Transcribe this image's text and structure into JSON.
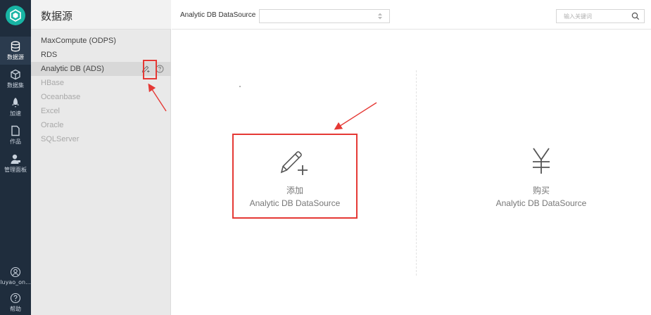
{
  "nav": {
    "items": [
      {
        "label": "数据源",
        "icon": "database-icon",
        "active": true
      },
      {
        "label": "数据集",
        "icon": "cube-icon"
      },
      {
        "label": "加速",
        "icon": "rocket-icon"
      },
      {
        "label": "作品",
        "icon": "document-icon"
      },
      {
        "label": "管理面板",
        "icon": "admin-user-icon"
      }
    ],
    "user": {
      "label": "luyao_on..."
    },
    "help": {
      "label": "帮助"
    }
  },
  "sidebar": {
    "title": "数据源",
    "items": [
      {
        "label": "MaxCompute (ODPS)",
        "state": "enabled"
      },
      {
        "label": "RDS",
        "state": "enabled"
      },
      {
        "label": "Analytic DB (ADS)",
        "state": "selected"
      },
      {
        "label": "HBase",
        "state": "disabled"
      },
      {
        "label": "Oceanbase",
        "state": "disabled"
      },
      {
        "label": "Excel",
        "state": "disabled"
      },
      {
        "label": "Oracle",
        "state": "disabled"
      },
      {
        "label": "SQLServer",
        "state": "disabled"
      }
    ]
  },
  "header": {
    "title": "Analytic DB DataSource",
    "select_value": "",
    "search_placeholder": "输入关键词"
  },
  "main": {
    "add_card": {
      "line1": "添加",
      "line2": "Analytic DB DataSource",
      "icon": "pencil-plus-icon"
    },
    "buy_card": {
      "line1": "购买",
      "line2": "Analytic DB DataSource",
      "icon": "yen-icon"
    }
  },
  "colors": {
    "rail_bg": "#1f2d3d",
    "brand": "#18b4a4",
    "annotation": "#e53935"
  }
}
